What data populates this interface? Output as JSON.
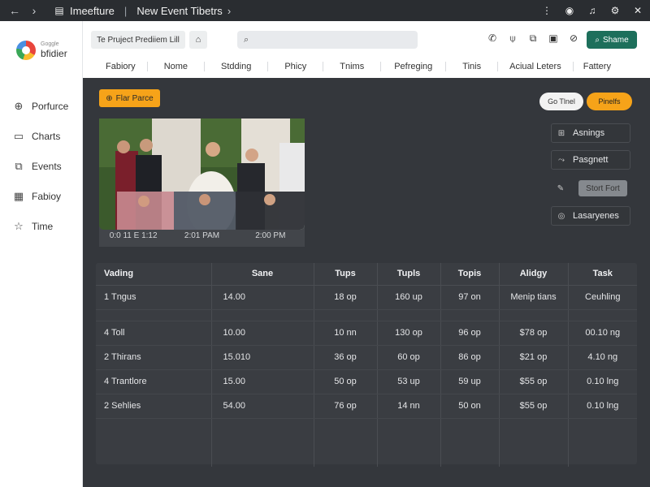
{
  "topbar": {
    "title": "Imeefture",
    "section": "New Event Tibetrs",
    "icons": [
      "back-arrow-icon",
      "forward-arrow-icon",
      "folder-icon",
      "more-icon",
      "globe-icon",
      "bell-icon",
      "gear-icon",
      "close-icon"
    ]
  },
  "sidebar": {
    "logo_small": "Goggle",
    "logo_big": "bfidier",
    "items": [
      {
        "label": "Porfurce",
        "icon": "compass-icon"
      },
      {
        "label": "Charts",
        "icon": "chart-icon"
      },
      {
        "label": "Events",
        "icon": "events-icon"
      },
      {
        "label": "Fabioy",
        "icon": "calendar-icon"
      },
      {
        "label": "Time",
        "icon": "star-icon"
      }
    ]
  },
  "header": {
    "label": "Te Pruject Prediiem Lill",
    "search_placeholder": "",
    "share_label": "Shame",
    "tabs": [
      "Fabiory",
      "Nome",
      "Stdding",
      "Phicy",
      "Tnims",
      "Pefreging",
      "Tinis",
      "Aciual Leters",
      "Fattery"
    ]
  },
  "main": {
    "new_button": "Flar Parce",
    "button_white": "Go Tlnel",
    "button_orange": "Pinelfs",
    "photo_times": [
      "0:0 11 E 1:12",
      "2:01 PAM",
      "2:00 PM"
    ],
    "right_panel": [
      {
        "label": "Asnings",
        "icon": "grid-icon"
      },
      {
        "label": "Pasgnett",
        "icon": "arrow-icon"
      },
      {
        "label": "Stort Fort",
        "icon": "pen-icon"
      },
      {
        "label": "Lasaryenes",
        "icon": "circle-icon"
      }
    ]
  },
  "table": {
    "headers": [
      "Vading",
      "Sane",
      "Tups",
      "Tupls",
      "Topis",
      "Alidgy",
      "Task"
    ],
    "rows": [
      [
        "1 Tngus",
        "14.00",
        "18 op",
        "160 up",
        "97 on",
        "Menip tians",
        "Ceuhling"
      ],
      [
        "4 Toll",
        "10.00",
        "10 nn",
        "130 op",
        "96 op",
        "$78 op",
        "00.10 ng"
      ],
      [
        "2 Thirans",
        "15.010",
        "36 op",
        "60 op",
        "86 op",
        "$21 op",
        "4.10 ng"
      ],
      [
        "4 Trantlore",
        "15.00",
        "50 op",
        "53 up",
        "59 up",
        "$55 op",
        "0.10 lng"
      ],
      [
        "2 Sehlies",
        "54.00",
        "76 op",
        "14 nn",
        "50 on",
        "$55 op",
        "0.10 lng"
      ]
    ]
  },
  "colors": {
    "accent_orange": "#f6a319",
    "share_green": "#1d6f5b",
    "dark_bg": "#34373c"
  }
}
